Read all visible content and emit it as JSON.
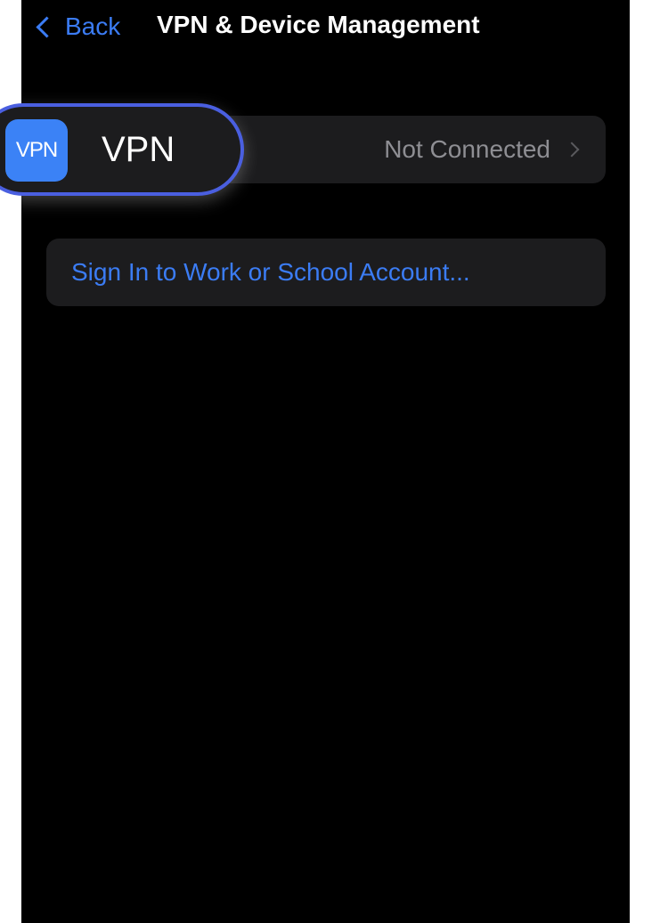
{
  "nav": {
    "back_label": "Back",
    "title": "VPN & Device Management"
  },
  "vpn": {
    "icon_text": "VPN",
    "label": "VPN",
    "status": "Not Connected"
  },
  "account": {
    "signin_label": "Sign In to Work or School Account..."
  },
  "colors": {
    "accent": "#3b7cf4",
    "background": "#000000",
    "cell": "#1c1c1e",
    "highlight_ring": "#4a5fe0",
    "vpn_icon": "#3b82f6"
  },
  "icons": {
    "back": "chevron-left-icon",
    "disclosure": "chevron-right-icon",
    "vpn_app": "vpn-app-icon"
  }
}
